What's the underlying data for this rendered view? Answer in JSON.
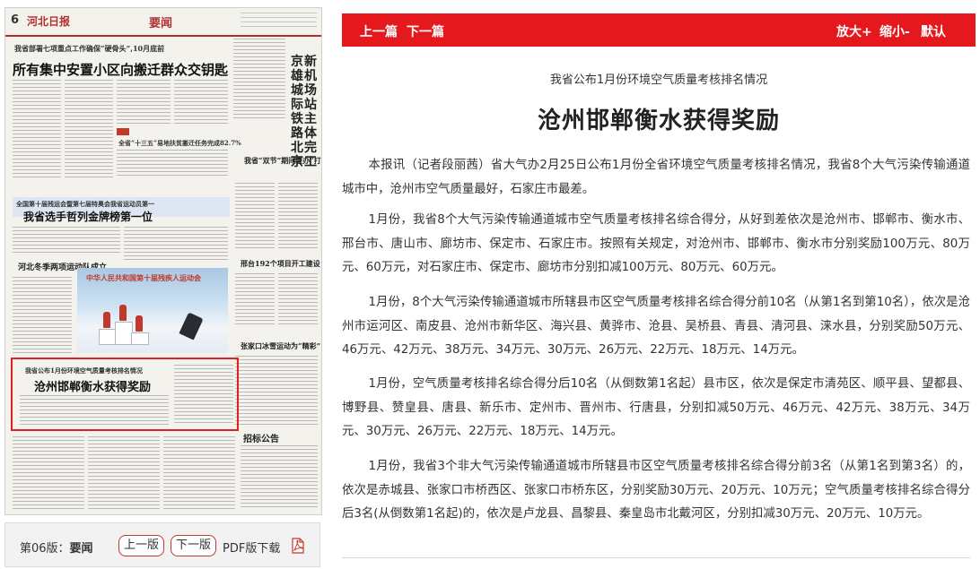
{
  "thumbnail": {
    "page_number": "6",
    "paper_name": "河北日报",
    "section": "要闻",
    "subheadline": "我省部署七项重点工作确保“硬骨头”,10月底前",
    "headline": "所有集中安置小区向搬迁群众交钥匙",
    "vertical_headline": "京雄城际铁路北京新机场站主体完工",
    "side_tag": "要闻",
    "side_sub": "全省“十三五”易地扶贫搬迁任务完成82.7%",
    "box_headline": "我省“双节”期间查办“打黑打非”案件57起",
    "sport_banner": "全国第十届残运会暨第七届特奥会我省运动员第一",
    "sport_headline": "我省选手哲列金牌榜第一位",
    "fire_brief": "河北冬季两项运动队成立",
    "project_headline": "邢台192个项目开工建设",
    "photo_title": "中华人民共和国第十届残疾人运动会",
    "column_headline": "张家口冰雪运动为“精彩”",
    "highlight_sub": "我省公布1月份环境空气质量考核排名情况",
    "highlight_headline": "沧州邯郸衡水获得奖励",
    "announcement": "招标公告"
  },
  "page_nav": {
    "page_prefix": "第06版：",
    "page_section": "要闻",
    "prev_page": "上一版",
    "next_page": "下一版",
    "pdf_download": "PDF版下载"
  },
  "toolbar": {
    "prev_article": "上一篇",
    "next_article": "下一篇",
    "zoom_in": "放大+",
    "zoom_out": "缩小-",
    "reset": "默认"
  },
  "article": {
    "pretitle": "我省公布1月份环境空气质量考核排名情况",
    "title": "沧州邯郸衡水获得奖励",
    "paragraphs": [
      "本报讯（记者段丽茜）省大气办2月25日公布1月份全省环境空气质量考核排名情况，我省8个大气污染传输通道城市中，沧州市空气质量最好，石家庄市最差。",
      "1月份，我省8个大气污染传输通道城市空气质量考核排名综合得分，从好到差依次是沧州市、邯郸市、衡水市、邢台市、唐山市、廊坊市、保定市、石家庄市。按照有关规定，对沧州市、邯郸市、衡水市分别奖励100万元、80万元、60万元，对石家庄市、保定市、廊坊市分别扣减100万元、80万元、60万元。",
      "1月份，8个大气污染传输通道城市所辖县市区空气质量考核排名综合得分前10名（从第1名到第10名），依次是沧州市运河区、南皮县、沧州市新华区、海兴县、黄骅市、沧县、吴桥县、青县、清河县、涞水县，分别奖励50万元、46万元、42万元、38万元、34万元、30万元、26万元、22万元、18万元、14万元。",
      "1月份，空气质量考核排名综合得分后10名（从倒数第1名起）县市区，依次是保定市清苑区、顺平县、望都县、博野县、赞皇县、唐县、新乐市、定州市、晋州市、行唐县，分别扣减50万元、46万元、42万元、38万元、34万元、30万元、26万元、22万元、18万元、14万元。",
      "1月份，我省3个非大气污染传输通道城市所辖县市区空气质量考核排名综合得分前3名（从第1名到第3名）的，依次是赤城县、张家口市桥西区、张家口市桥东区，分别奖励30万元、20万元、10万元；空气质量考核排名综合得分后3名(从倒数第1名起)的，依次是卢龙县、昌黎县、秦皇岛市北戴河区，分别扣减30万元、20万元、10万元。"
    ]
  },
  "colors": {
    "toolbar_red": "#e5181e",
    "highlight_red": "#e02020",
    "nav_border": "#c0392b"
  }
}
